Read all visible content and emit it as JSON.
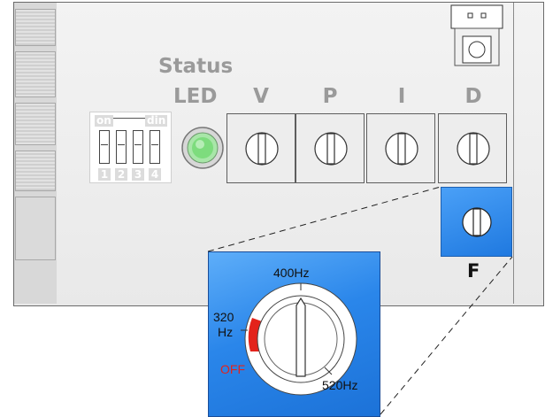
{
  "labels": {
    "status": "Status",
    "led": "LED",
    "columns": [
      "V",
      "P",
      "I",
      "D"
    ],
    "f_label": "F"
  },
  "dip_switch": {
    "on_label": "on",
    "din_label": "din",
    "numbers": [
      "1",
      "2",
      "3",
      "4"
    ]
  },
  "led": {
    "color": "#7ddc7d"
  },
  "zoom_dial": {
    "top_label": "400Hz",
    "left_label_line1": "320",
    "left_label_line2": "Hz",
    "off_label": "OFF",
    "right_label": "520Hz"
  },
  "colors": {
    "accent_blue": "#2a86ea",
    "off_red": "#e3231b",
    "label_gray": "#9a9a9a"
  }
}
